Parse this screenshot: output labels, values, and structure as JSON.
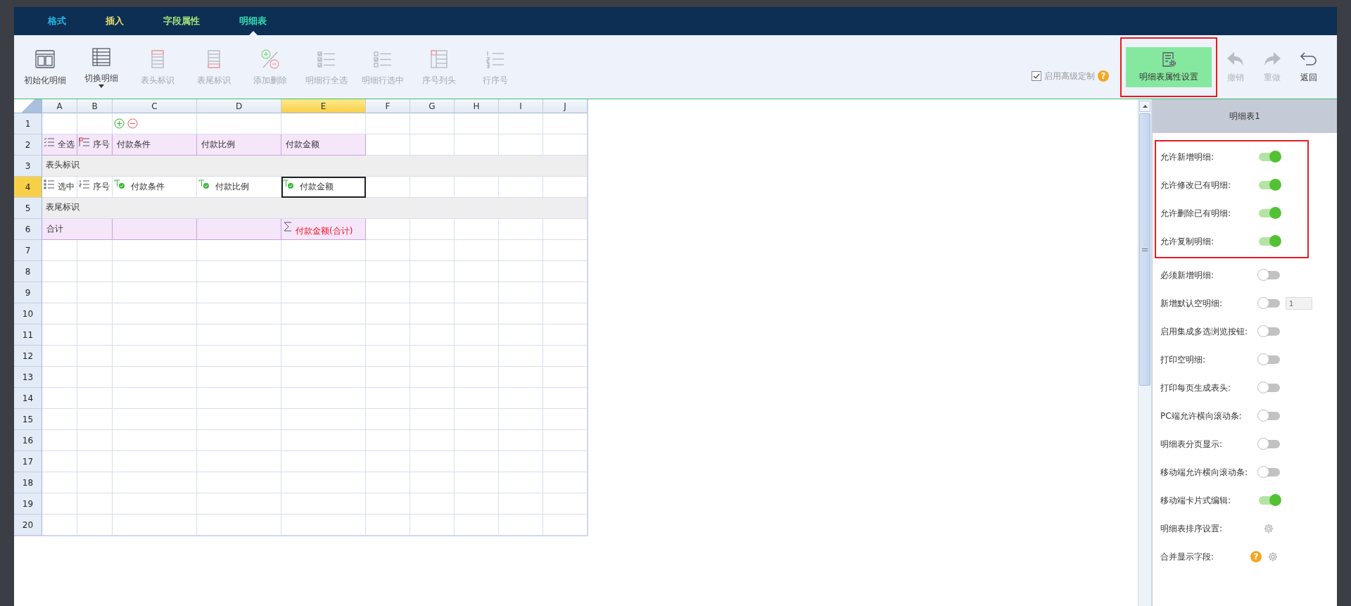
{
  "tabs": [
    {
      "label": "格式",
      "selected": false
    },
    {
      "label": "插入",
      "selected": false
    },
    {
      "label": "字段属性",
      "selected": false
    },
    {
      "label": "明细表",
      "selected": true
    }
  ],
  "toolbar": {
    "items": [
      {
        "label": "初始化明细",
        "disabled": false
      },
      {
        "label": "切换明细",
        "disabled": false,
        "dropdown": true
      },
      {
        "label": "表头标识",
        "disabled": true
      },
      {
        "label": "表尾标识",
        "disabled": true
      },
      {
        "label": "添加删除",
        "disabled": true
      },
      {
        "label": "明细行全选",
        "disabled": true
      },
      {
        "label": "明细行选中",
        "disabled": true
      },
      {
        "label": "序号列头",
        "disabled": true
      },
      {
        "label": "行序号",
        "disabled": true
      }
    ],
    "advanced": {
      "label": "启用高级定制",
      "checked": true,
      "help": "?"
    },
    "settings_button": {
      "label": "明细表属性设置",
      "highlighted": true
    },
    "actions": [
      {
        "label": "撤销",
        "disabled": true
      },
      {
        "label": "重做",
        "disabled": true
      },
      {
        "label": "返回",
        "disabled": false
      }
    ]
  },
  "sheet": {
    "columns": [
      {
        "label": "A",
        "selected": false
      },
      {
        "label": "B",
        "selected": false
      },
      {
        "label": "C",
        "selected": false
      },
      {
        "label": "D",
        "selected": false
      },
      {
        "label": "E",
        "selected": true
      },
      {
        "label": "F",
        "selected": false
      },
      {
        "label": "G",
        "selected": false
      },
      {
        "label": "H",
        "selected": false
      },
      {
        "label": "I",
        "selected": false
      },
      {
        "label": "J",
        "selected": false
      }
    ],
    "rows": [
      {
        "label": "1",
        "selected": false,
        "cells": [
          {
            "kind": "empty"
          },
          {
            "kind": "empty"
          },
          {
            "kind": "add-remove",
            "selected": false
          },
          {
            "kind": "empty"
          },
          {
            "kind": "empty"
          },
          {
            "kind": "empty"
          },
          {
            "kind": "empty"
          },
          {
            "kind": "empty"
          },
          {
            "kind": "empty"
          },
          {
            "kind": "empty"
          }
        ]
      },
      {
        "label": "2",
        "selected": false,
        "cells": [
          {
            "kind": "check-all",
            "text": "全选",
            "selected": false
          },
          {
            "kind": "serial",
            "text": "序号",
            "selected": false
          },
          {
            "kind": "header",
            "text": "付款条件",
            "selected": false
          },
          {
            "kind": "header",
            "text": "付款比例",
            "selected": false
          },
          {
            "kind": "header",
            "text": "付款金额",
            "selected": false
          },
          {
            "kind": "empty"
          },
          {
            "kind": "empty"
          },
          {
            "kind": "empty"
          },
          {
            "kind": "empty"
          },
          {
            "kind": "empty"
          }
        ]
      },
      {
        "label": "3",
        "selected": false,
        "cells": [
          {
            "kind": "band",
            "text": "表头标识",
            "selected": false
          }
        ]
      },
      {
        "label": "4",
        "selected": true,
        "cells": [
          {
            "kind": "check-one",
            "text": "选中",
            "selected": false
          },
          {
            "kind": "row-number",
            "text": "序号",
            "selected": false
          },
          {
            "kind": "field",
            "text": "付款条件",
            "selected": false
          },
          {
            "kind": "field",
            "text": "付款比例",
            "selected": false
          },
          {
            "kind": "field",
            "text": "付款金额",
            "selected": true
          },
          {
            "kind": "empty"
          },
          {
            "kind": "empty"
          },
          {
            "kind": "empty"
          },
          {
            "kind": "empty"
          },
          {
            "kind": "empty"
          }
        ]
      },
      {
        "label": "5",
        "selected": false,
        "cells": [
          {
            "kind": "band",
            "text": "表尾标识",
            "selected": false
          }
        ]
      },
      {
        "label": "6",
        "selected": false,
        "cells": [
          {
            "kind": "total",
            "text": "合计",
            "selected": false
          },
          {
            "kind": "header",
            "selected": false
          },
          {
            "kind": "header",
            "selected": false
          },
          {
            "kind": "sum",
            "text": "付款金额(合计)",
            "selected": false
          },
          {
            "kind": "empty"
          },
          {
            "kind": "empty"
          },
          {
            "kind": "empty"
          },
          {
            "kind": "empty"
          },
          {
            "kind": "empty"
          }
        ]
      },
      {
        "label": "7",
        "selected": false
      },
      {
        "label": "8",
        "selected": false
      },
      {
        "label": "9",
        "selected": false
      },
      {
        "label": "10",
        "selected": false
      },
      {
        "label": "11",
        "selected": false
      },
      {
        "label": "12",
        "selected": false
      },
      {
        "label": "13",
        "selected": false
      },
      {
        "label": "14",
        "selected": false
      },
      {
        "label": "15",
        "selected": false
      },
      {
        "label": "16",
        "selected": false
      },
      {
        "label": "17",
        "selected": false
      },
      {
        "label": "18",
        "selected": false
      },
      {
        "label": "19",
        "selected": false
      },
      {
        "label": "20",
        "selected": false
      }
    ]
  },
  "panel": {
    "title": "明细表1",
    "sections": [
      {
        "highlighted": true,
        "items": [
          {
            "kind": "toggle",
            "label": "允许新增明细:",
            "on": true
          },
          {
            "kind": "toggle",
            "label": "允许修改已有明细:",
            "on": true
          },
          {
            "kind": "toggle",
            "label": "允许删除已有明细:",
            "on": true
          },
          {
            "kind": "toggle",
            "label": "允许复制明细:",
            "on": true
          }
        ]
      },
      {
        "highlighted": false,
        "items": [
          {
            "kind": "toggle",
            "label": "必须新增明细:",
            "on": false
          },
          {
            "kind": "toggle-number",
            "label": "新增默认空明细:",
            "on": false,
            "value": "1"
          },
          {
            "kind": "toggle",
            "label": "启用集成多选浏览按钮:",
            "on": false
          },
          {
            "kind": "toggle",
            "label": "打印空明细:",
            "on": false
          },
          {
            "kind": "toggle",
            "label": "打印每页生成表头:",
            "on": false
          },
          {
            "kind": "toggle",
            "label": "PC端允许横向滚动条:",
            "on": false
          },
          {
            "kind": "toggle",
            "label": "明细表分页显示:",
            "on": false
          },
          {
            "kind": "toggle",
            "label": "移动端允许横向滚动条:",
            "on": false
          },
          {
            "kind": "toggle",
            "label": "移动端卡片式编辑:",
            "on": true
          },
          {
            "kind": "gear",
            "label": "明细表排序设置:"
          },
          {
            "kind": "help-gear",
            "label": "合并显示字段:",
            "help": "?"
          }
        ]
      }
    ]
  }
}
